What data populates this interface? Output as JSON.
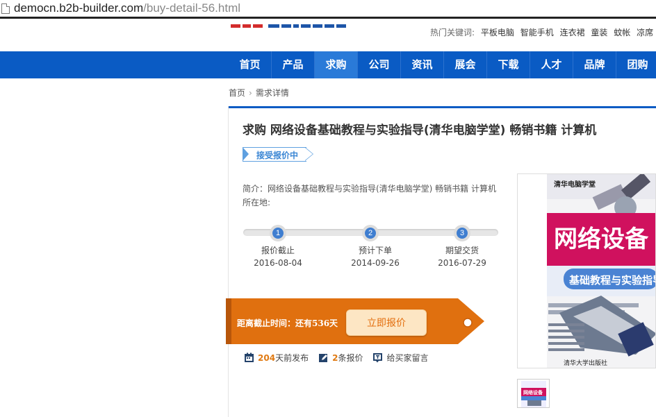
{
  "browser": {
    "host": "democn.b2b-builder.com",
    "path": "/buy-detail-56.html"
  },
  "header": {
    "hotwords_label": "热门关键词:",
    "hotwords": [
      "平板电脑",
      "智能手机",
      "连衣裙",
      "童装",
      "蚊帐",
      "凉席"
    ]
  },
  "nav": {
    "items": [
      "首页",
      "产品",
      "求购",
      "公司",
      "资讯",
      "展会",
      "下载",
      "人才",
      "品牌",
      "团购"
    ],
    "active": "求购"
  },
  "breadcrumb": {
    "home": "首页",
    "current": "需求详情"
  },
  "detail": {
    "title": "求购 网络设备基础教程与实验指导(清华电脑学堂) 畅销书籍 计算机",
    "status": "接受报价中",
    "intro": "简介：网络设备基础教程与实验指导(清华电脑学堂) 畅销书籍 计算机",
    "location": "所在地:",
    "steps": [
      {
        "num": "1",
        "label": "报价截止",
        "date": "2016-08-04"
      },
      {
        "num": "2",
        "label": "预计下单",
        "date": "2014-09-26"
      },
      {
        "num": "3",
        "label": "期望交货",
        "date": "2016-07-29"
      }
    ],
    "countdown": "距离截止时间：还有536天",
    "quote_button": "立即报价",
    "stats": {
      "days_num": "204",
      "days_text": "天前发布",
      "quotes_num": "2",
      "quotes_text": "条报价",
      "message": "给买家留言"
    }
  },
  "cover": {
    "series": "清华电脑学堂",
    "title_line1": "网络设备",
    "title_line2": "基础教程与实验指导",
    "publisher": "清华大学出版社",
    "thumb_title": "网络设备"
  },
  "colors": {
    "nav": "#0a5bc4",
    "orange": "#e0700f",
    "accent": "#3a86d4"
  }
}
